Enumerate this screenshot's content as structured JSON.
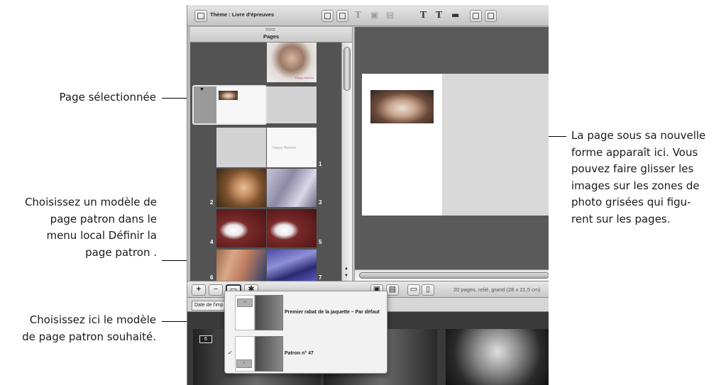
{
  "callouts": {
    "selected_page": "Page sélectionnée",
    "choose_master": "Choisissez un modèle de\npage patron dans le\nmenu local Définir la\npage patron .",
    "choose_here": "Choisissez ici le modèle\nde page patron souhaité.",
    "new_layout": "La page sous sa nouvelle\nforme apparaît ici. Vous\npouvez faire glisser les\nimages sur les zones de\nphoto grisées qui figu-\nrent sur les pages."
  },
  "toolbar": {
    "theme_label": "Thème : Livre d'épreuves",
    "text_glyphs": [
      "T",
      "T",
      "T"
    ]
  },
  "pages_panel": {
    "title": "Pages",
    "happy_married": "Happy Married",
    "page_numbers": [
      "1",
      "2",
      "3",
      "4",
      "5",
      "6",
      "7"
    ]
  },
  "bottom_bar": {
    "add_button": "+",
    "remove_button": "−",
    "status": "20 pages, relié, grand (28 x 21,5 cm)"
  },
  "browser": {
    "tab_label": "Date de l'imp",
    "badge": "6"
  },
  "master_menu": {
    "items": [
      {
        "label": "Premier rabat de la jaquette – Par défaut",
        "checked": false
      },
      {
        "label": "Patron n° 47",
        "checked": true
      }
    ],
    "checkmark": "✓"
  }
}
